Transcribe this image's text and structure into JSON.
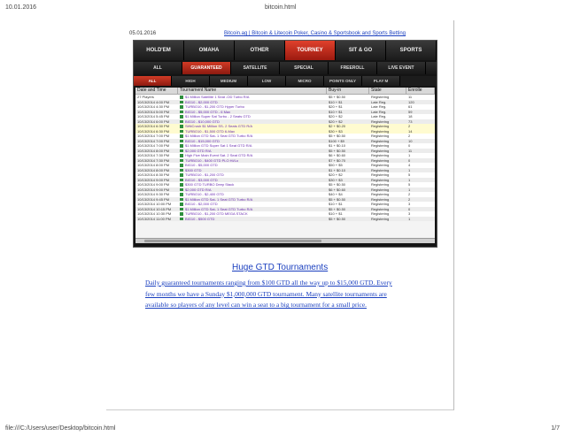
{
  "print_header": {
    "date": "10.01.2016",
    "title": "bitcoin.html"
  },
  "print_footer": {
    "path": "file:///C:/Users/user/Desktop/bitcoin.html",
    "page": "1/7"
  },
  "page": {
    "date": "05.01.2016",
    "link": "Bitcoin.ag | Bitcoin & Litecoin Poker, Casino & Sportsbook and Sports Betting"
  },
  "screenshot": {
    "top_tabs": [
      "HOLD'EM",
      "OMAHA",
      "OTHER",
      "TOURNEY",
      "SIT & GO",
      "SPORTS",
      "CASI"
    ],
    "active_top_tab": "TOURNEY",
    "mid_tabs": [
      "ALL",
      "GUARANTEED",
      "SATELLITE",
      "SPECIAL",
      "FREEROLL",
      "LIVE EVENT",
      "PRIV"
    ],
    "active_mid_tab": "GUARANTEED",
    "sub_tabs": [
      "ALL",
      "HIGH",
      "MEDIUM",
      "LOW",
      "MICRO",
      "POINTS ONLY",
      "PLAY M"
    ],
    "active_sub_tab": "ALL",
    "columns": [
      "Date and Time",
      "Tournament Name",
      "Buy-in",
      "State",
      "Enrolle"
    ],
    "rows": [
      [
        "27 Players",
        "$1 Million Satellite 1 Seat -OD Turbo R/A",
        "$5 + $0.50",
        "Registering",
        "11"
      ],
      [
        "10/13/2014 4:00 PM",
        "BIG10 - $2,000 GTD",
        "$10 + $1",
        "Late Reg.",
        "120"
      ],
      [
        "10/13/2014 4:30 PM",
        "TURBO10 - $1,200 GTD Hyper Turbo",
        "$20 + $1",
        "Late Reg.",
        "61"
      ],
      [
        "10/13/2014 5:00 PM",
        "BIG10 - $5,000 GTD - 6 Max",
        "$10 + $1",
        "Late Reg.",
        "59"
      ],
      [
        "10/13/2014 5:45 PM",
        "$1 Million Super Sat Turbo - 2 Seats GTD",
        "$20 + $2",
        "Late Reg.",
        "18"
      ],
      [
        "10/13/2014 6:00 PM",
        "BIG10 - $10,000 GTD",
        "$20 + $2",
        "Registering",
        "73"
      ],
      [
        "10/13/2014 6:30 PM",
        "SitNCrush $1 Million SS- 2 Seats GTD R/A",
        "$2 + $0.20",
        "Registering",
        "2"
      ],
      [
        "10/13/2014 6:30 PM",
        "TURBO10 - $1,500 GTD 6-Max",
        "$30 + $3",
        "Registering",
        "14"
      ],
      [
        "10/13/2014 7:00 PM",
        "$1 Million GTD Sat- 1 Seat GTD Turbo R/A",
        "$5 + $0.50",
        "Registering",
        "2"
      ],
      [
        "10/13/2014 7:00 PM",
        "BIG10 - $15,000 GTD",
        "$100 + $9",
        "Registering",
        "10"
      ],
      [
        "10/13/2014 7:00 PM",
        "$1 Million GTD Super Sat 1 Seat GTD R/A",
        "$1 + $0.10",
        "Registering",
        "0"
      ],
      [
        "10/13/2014 8:00 PM",
        "$2,000 GTD R/A",
        "$5 + $0.50",
        "Registering",
        "11"
      ],
      [
        "10/13/2014 7:30 PM",
        "High Five Main Event Sat. 2 Seat GTD R/A",
        "$6 + $0.60",
        "Registering",
        "1"
      ],
      [
        "10/13/2014 7:30 PM",
        "TURBO10 - $400 GTD PLO Hi/Lo",
        "$7 + $0.70",
        "Registering",
        "0"
      ],
      [
        "10/13/2014 8:00 PM",
        "BIG10 - $5,000 GTD",
        "$50 + $5",
        "Registering",
        "4"
      ],
      [
        "10/13/2014 8:00 PM",
        "$300 GTD",
        "$1 + $0.10",
        "Registering",
        "1"
      ],
      [
        "10/13/2014 8:30 PM",
        "TURBO10 - $1,200 GTD",
        "$20 + $2",
        "Registering",
        "5"
      ],
      [
        "10/13/2014 9:00 PM",
        "BIG10 - $3,000 GTD",
        "$30 + $3",
        "Registering",
        "1"
      ],
      [
        "10/13/2014 9:00 PM",
        "$300 GTD TURBO Deep Stack",
        "$5 + $0.50",
        "Registering",
        "5"
      ],
      [
        "10/13/2014 9:00 PM",
        "$2,000 GTD R/A",
        "$6 + $0.60",
        "Registering",
        "1"
      ],
      [
        "10/13/2014 9:30 PM",
        "TURBO10 - $2,400 GTD",
        "$40 + $4",
        "Registering",
        "2"
      ],
      [
        "10/13/2014 9:45 PM",
        "$1 Million GTD Sat- 1 Seat GTD Turbo R/A",
        "$5 + $0.50",
        "Registering",
        "2"
      ],
      [
        "10/13/2014 10:00 PM",
        "BIG10 - $2,000 GTD",
        "$10 + $1",
        "Registering",
        "3"
      ],
      [
        "10/13/2014 10:15 PM",
        "$1 Million GTD Sat- 1 Seat GTD Turbo R/A",
        "$5 + $0.50",
        "Registering",
        "0"
      ],
      [
        "10/13/2014 10:30 PM",
        "TURBO10 - $1,200 GTD MEGA STACK",
        "$10 + $1",
        "Registering",
        "3"
      ],
      [
        "10/13/2014 11:00 PM",
        "BIG10 - $500 GTD",
        "$5 + $0.50",
        "Registering",
        "1"
      ]
    ]
  },
  "article": {
    "title": "Huge GTD Tournaments",
    "body": "Daily guaranteed tournaments ranging from $100 GTD all the way up to $15,000 GTD. Every few months we have a Sunday $1,000,000 GTD tournament. Many satellite tournaments are available so players of any level can win a seat to a big tournament for a small price."
  }
}
